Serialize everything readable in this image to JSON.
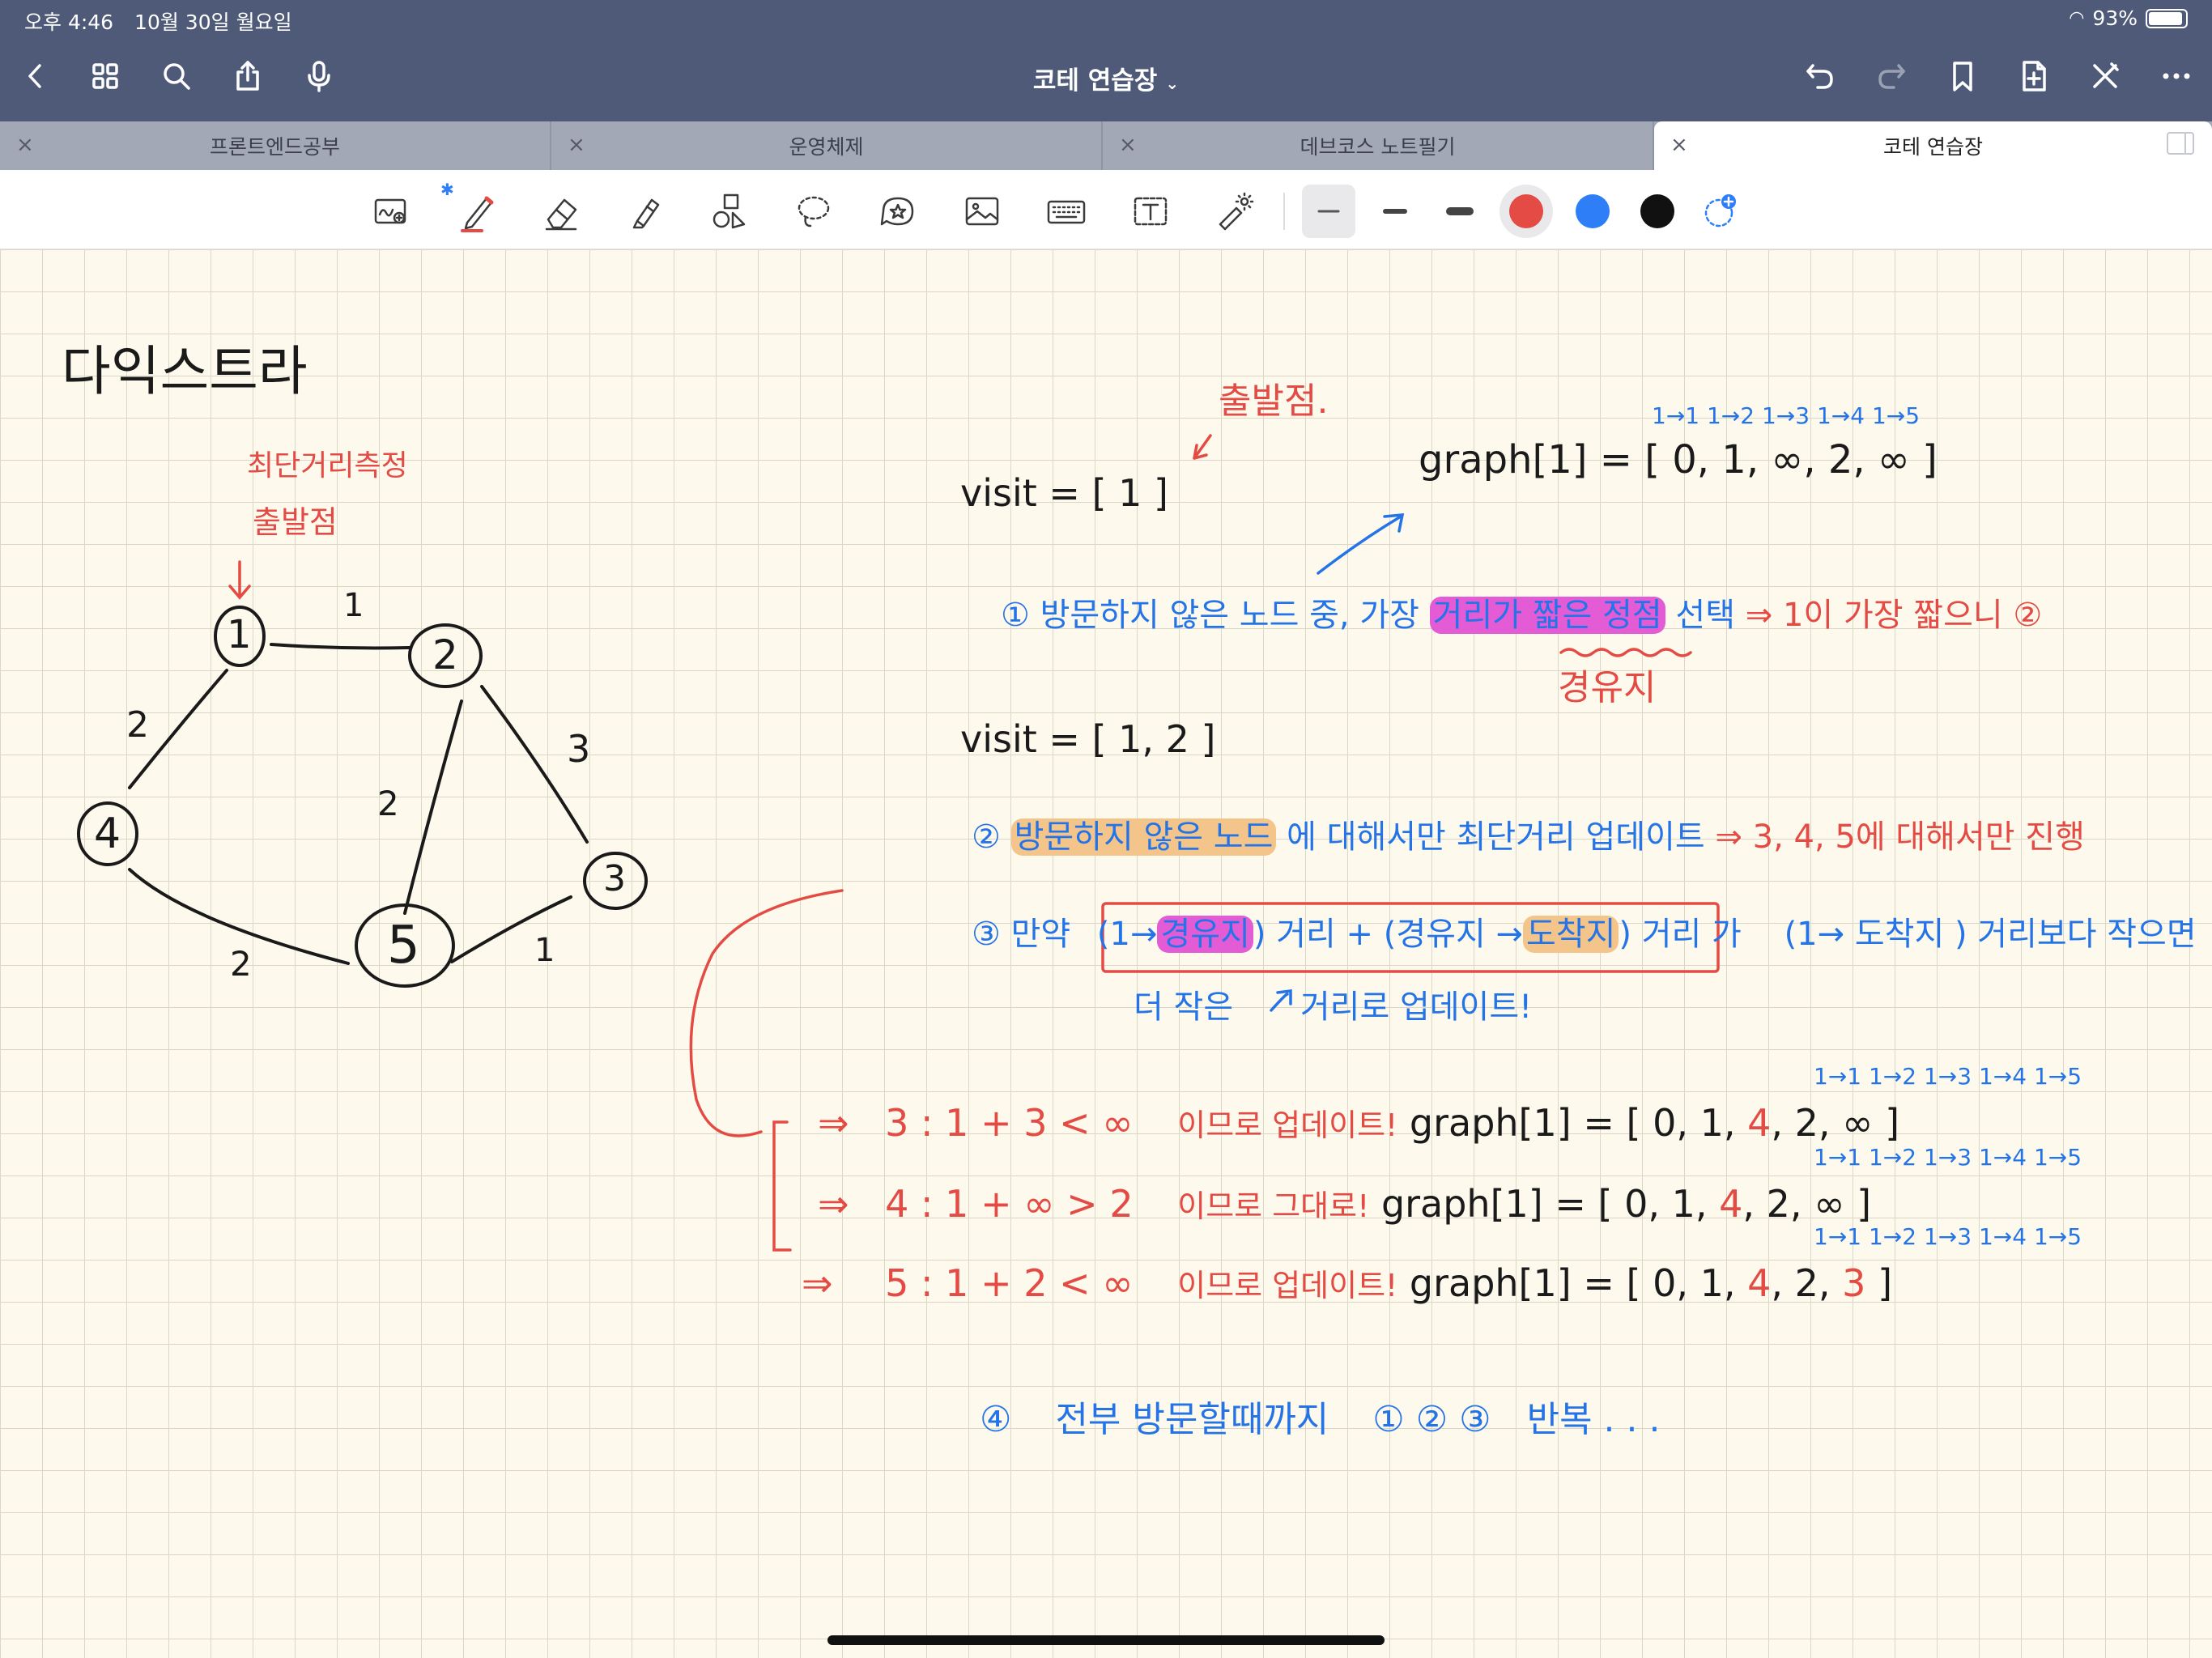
{
  "status": {
    "time": "오후 4:46",
    "date": "10월 30일 월요일",
    "battery": "93%",
    "battery_level": 0.93
  },
  "nav": {
    "title": "코테 연습장",
    "icons": [
      "chevron-left-icon",
      "grid-icon",
      "search-icon",
      "share-icon",
      "mic-icon",
      "undo-icon",
      "redo-icon",
      "bookmark-icon",
      "add-page-icon",
      "close-pen-icon",
      "more-icon"
    ]
  },
  "tabs": [
    {
      "label": "프론트엔드공부",
      "close": "×"
    },
    {
      "label": "운영체제",
      "close": "×"
    },
    {
      "label": "데브코스 노트필기",
      "close": "×"
    },
    {
      "label": "코테 연습장",
      "close": "×"
    }
  ],
  "toolbar": {
    "tools": [
      "zoom-write-icon",
      "pen-icon",
      "eraser-icon",
      "highlighter-icon",
      "shapes-icon",
      "lasso-icon",
      "sticker-icon",
      "image-icon",
      "keyboard-icon",
      "text-icon",
      "laser-pointer-icon"
    ],
    "bluetooth": "✱",
    "colors": {
      "red": "#e34b44",
      "blue": "#2d7ef7",
      "black": "#111111"
    }
  },
  "note": {
    "title": "다익스트라",
    "left_label_1": "최단거리측정",
    "left_label_2": "출발점",
    "graph": {
      "nodes": [
        "1",
        "2",
        "3",
        "4",
        "5"
      ],
      "weights": {
        "w12": "1",
        "w14": "2",
        "w25": "2",
        "w23": "3",
        "w45": "2",
        "w53": "1"
      }
    },
    "start_label": "출발점.",
    "visit1": "visit  =  [ 1 ]",
    "graph_row1": "graph[1] = [ 0, 1, ∞, 2, ∞ ]",
    "graph_header": "1→1  1→2  1→3  1→4  1→5",
    "step1_num": "①",
    "step1_a": "방문하지 않은 노드 중, 가장",
    "step1_hl": "거리가 짧은 정점",
    "step1_b": "선택",
    "step1_arrow": "⇒",
    "step1_c": "1이 가장 짧으니",
    "step1_circ": "②",
    "waypoint": "경유지",
    "visit2": "visit  = [ 1, 2 ]",
    "step2_num": "②",
    "step2_hl": "방문하지 않은 노드",
    "step2_a": "에 대해서만  최단거리 업데이트",
    "step2_b": "⇒  3, 4, 5에 대해서만  진행",
    "step3_num": "③",
    "step3_a": "만약",
    "step3_box_1": "(1→",
    "step3_box_hl1": "경유지",
    "step3_box_2": ") 거리  +  (경유지 →",
    "step3_box_hl2": "도착지",
    "step3_box_3": ") 거리",
    "step3_b": "가",
    "step3_c": "(1→ 도착지 ) 거리보다 작으면",
    "step3_d": "더 작은",
    "step3_e": "거리로 업데이트!",
    "rows": [
      {
        "arrow": "⇒",
        "lhs": "3  :  1 + 3   <   ∞",
        "msg": "이므로 업데이트!",
        "graph": "graph[1] = [ 0, 1,",
        "v3": "4",
        "tail": ",  2,",
        "v5": "∞",
        "end": "]"
      },
      {
        "arrow": "⇒",
        "lhs": "4  :  1 +  ∞   >   2",
        "msg": "이므로 그대로!",
        "graph": "graph[1] = [ 0, 1,",
        "v3": "4",
        "tail": ",  2,",
        "v5": "∞",
        "end": "]"
      },
      {
        "arrow": "⇒",
        "lhs": "5  :  1 +  2   <   ∞",
        "msg": "이므로 업데이트!",
        "graph": "graph[1] = [ 0, 1,",
        "v3": "4",
        "tail": ",  2,",
        "v5": "3",
        "end": "]"
      }
    ],
    "step4_num": "④",
    "step4_a": "전부  방문할때까지",
    "step4_b": "① ② ③",
    "step4_c": "반복 . . ."
  }
}
